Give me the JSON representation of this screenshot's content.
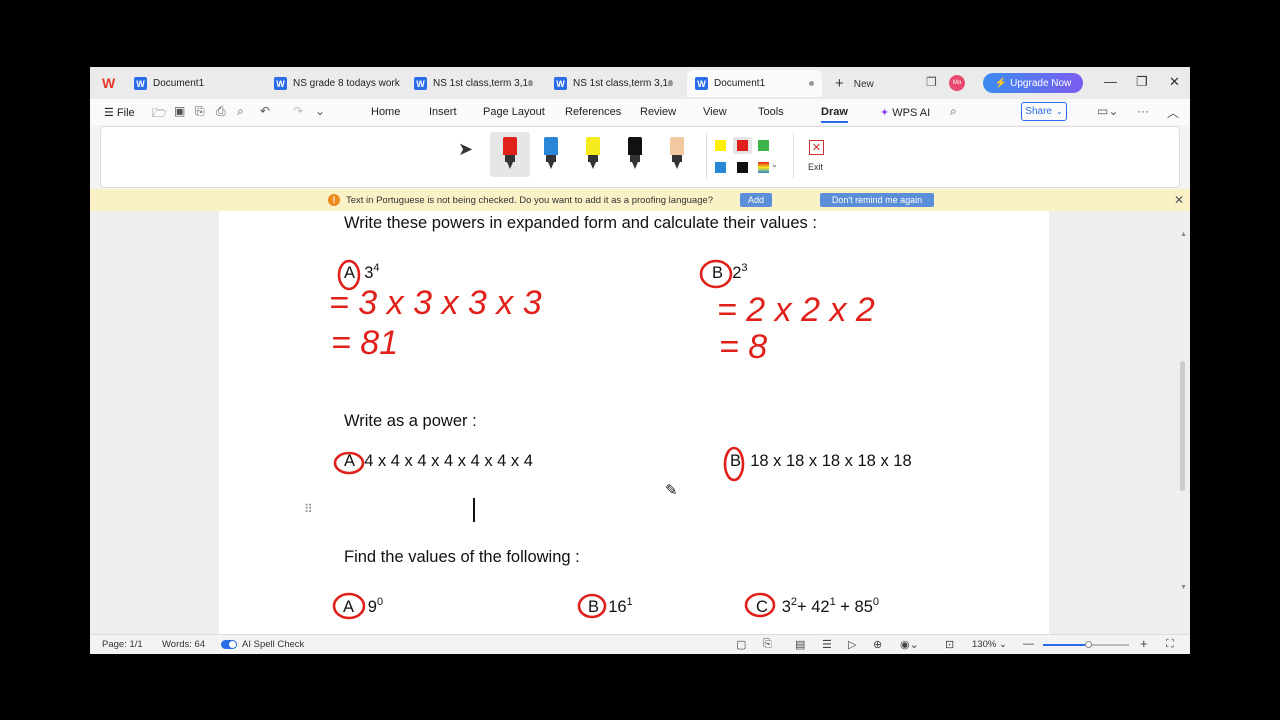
{
  "window": {
    "tabs": [
      {
        "label": "Document1",
        "active": false
      },
      {
        "label": "NS grade 8 todays work",
        "active": false
      },
      {
        "label": "NS 1st class,term 3,1s",
        "active": false
      },
      {
        "label": "NS 1st class,term 3,1s",
        "active": false
      },
      {
        "label": "Document1",
        "active": true
      }
    ],
    "new_tab_label": "New",
    "upgrade_label": "Upgrade Now",
    "avatar_text": "Mo"
  },
  "menu": {
    "file_label": "File",
    "items": [
      "Home",
      "Insert",
      "Page Layout",
      "References",
      "Review",
      "View",
      "Tools",
      "Draw",
      "WPS AI"
    ],
    "active_item": "Draw",
    "share_label": "Share"
  },
  "ribbon": {
    "pens": [
      {
        "name": "red-pen",
        "color": "#e0201b",
        "selected": true
      },
      {
        "name": "blue-pen",
        "color": "#2a86d6",
        "selected": false
      },
      {
        "name": "yellow-highlighter",
        "color": "#f5ea1c",
        "selected": false
      },
      {
        "name": "black-pen",
        "color": "#111111",
        "selected": false
      },
      {
        "name": "pink-highlighter",
        "color": "#f2c8a0",
        "selected": false
      }
    ],
    "swatches": [
      "#ffee00",
      "#e0201b",
      "#3cb54a",
      "#2a86d6",
      "#111111"
    ],
    "exit_label": "Exit"
  },
  "notification": {
    "icon": "warning-icon",
    "text": "Text in Portuguese is not being checked. Do you want to add it as a proofing language?",
    "add_label": "Add",
    "dismiss_label": "Don't remind me again"
  },
  "document": {
    "heading1": "Write these powers in expanded form and calculate their values :",
    "q1a_label": "A",
    "q1a_base": "3",
    "q1a_exp": "4",
    "q1b_label": "B",
    "q1b_base": "2",
    "q1b_exp": "3",
    "heading2": "Write as a power :",
    "q2a_label": "A",
    "q2a_text": "4 x 4 x 4 x 4 x 4 x 4 x 4",
    "q2b_label": "B",
    "q2b_text": "18 x 18 x 18 x 18 x 18",
    "heading3": "Find the values of the following :",
    "q3a_label": "A",
    "q3a_base": "9",
    "q3a_exp": "0",
    "q3b_label": "B",
    "q3b_base": "16",
    "q3b_exp": "1",
    "q3c_label": "C",
    "q3c_t1_base": "3",
    "q3c_t1_exp": "2",
    "q3c_op1": "+ ",
    "q3c_t2_base": "42",
    "q3c_t2_exp": "1",
    "q3c_op2": " + ",
    "q3c_t3_base": "85",
    "q3c_t3_exp": "0"
  },
  "ink_annotations": {
    "color": "#e0201b",
    "a_line1": "= 3 x 3 x 3 x 3",
    "a_line2": "= 81",
    "b_line1": "= 2 x 2 x 2",
    "b_line2": "= 8"
  },
  "status": {
    "page": "Page: 1/1",
    "words": "Words: 64",
    "spell": "AI Spell Check",
    "zoom": "130%",
    "zoom_level_percent": 130
  }
}
